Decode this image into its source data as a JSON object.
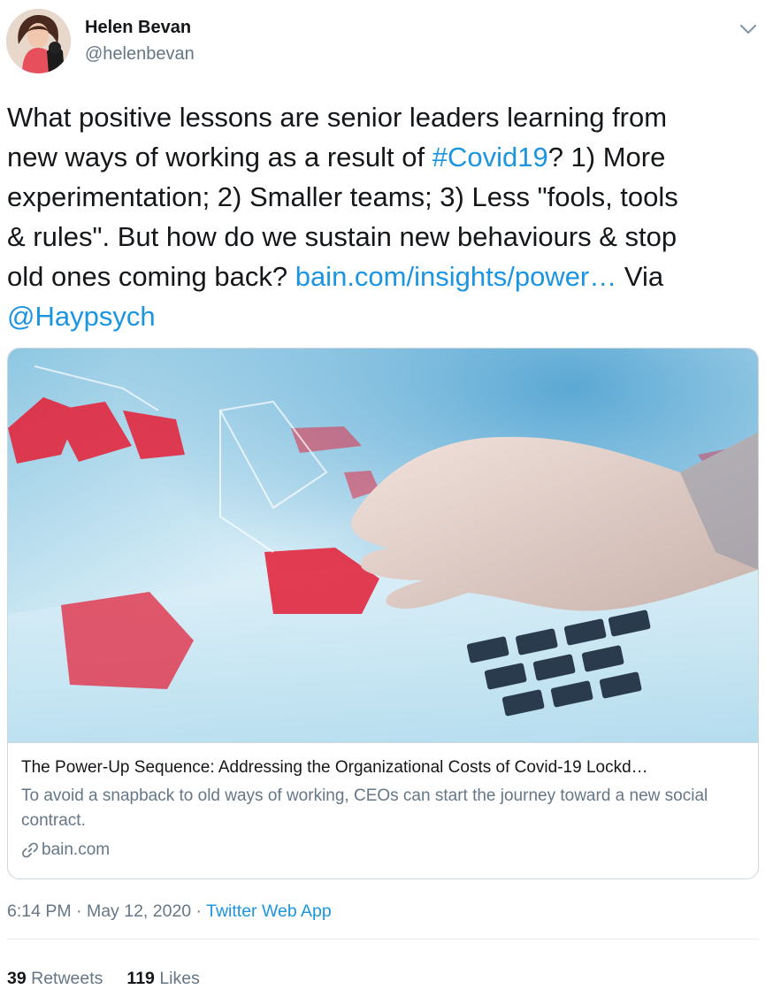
{
  "author": {
    "name": "Helen Bevan",
    "handle": "@helenbevan"
  },
  "tweet": {
    "lines": [
      [
        {
          "text": "What positive lessons are senior leaders learning from"
        }
      ],
      [
        {
          "text": "new ways of working as a result of "
        },
        {
          "text": "#Covid19",
          "link": true
        },
        {
          "text": "? 1) More"
        }
      ],
      [
        {
          "text": "experimentation; 2) Smaller teams; 3) Less \"fools, tools"
        }
      ],
      [
        {
          "text": "& rules\". But how do we sustain new behaviours & stop"
        }
      ],
      [
        {
          "text": "old ones coming back? "
        },
        {
          "text": "bain.com/insights/power…",
          "link": true
        },
        {
          "text": " Via"
        }
      ],
      [
        {
          "text": "@Haypsych",
          "link": true
        }
      ]
    ]
  },
  "card": {
    "title": "The Power-Up Sequence: Addressing the Organizational Costs of Covid-19 Lockd…",
    "description": "To avoid a snapback to old ways of working, CEOs can start the journey toward a new social contract.",
    "domain": "bain.com"
  },
  "meta": {
    "time": "6:14 PM",
    "separator": " · ",
    "date": "May 12, 2020",
    "separator2": " · ",
    "source": "Twitter Web App"
  },
  "stats": {
    "retweets_count": "39",
    "retweets_label": "Retweets",
    "likes_count": "119",
    "likes_label": "Likes"
  },
  "colors": {
    "link": "#1b95e0",
    "secondary": "#657786",
    "primary": "#14171a",
    "border": "#ccd6dd"
  },
  "icons": {
    "caret": "chevron-down-icon",
    "domain": "link-icon"
  }
}
